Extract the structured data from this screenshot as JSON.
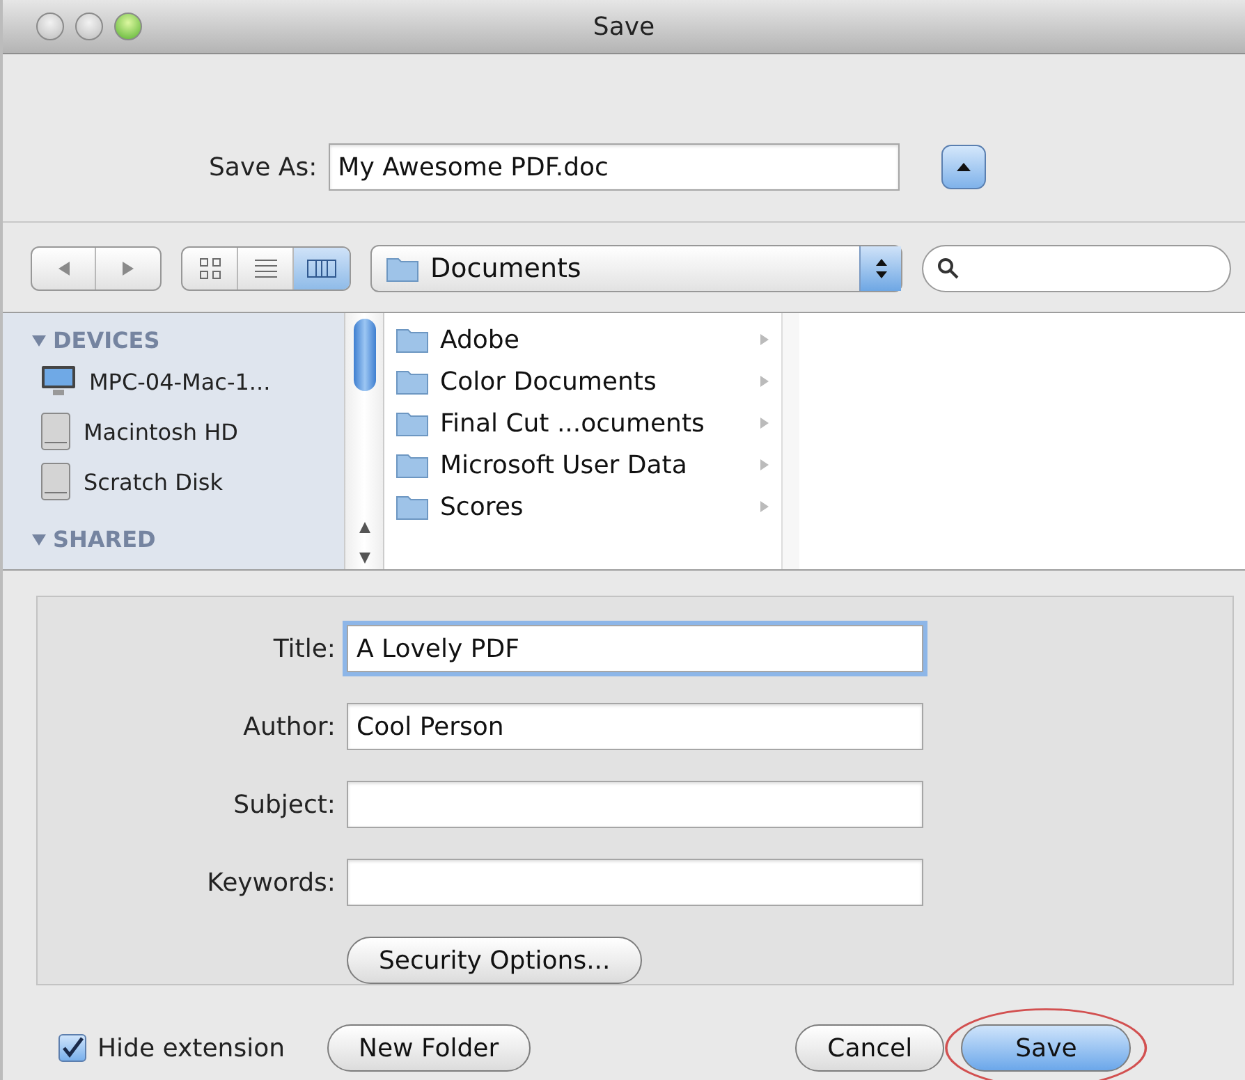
{
  "window": {
    "title": "Save"
  },
  "save_as": {
    "label": "Save As:",
    "value": "My Awesome PDF.doc",
    "expanded": true
  },
  "toolbar": {
    "views": [
      {
        "kind": "icons",
        "selected": false
      },
      {
        "kind": "list",
        "selected": false
      },
      {
        "kind": "columns",
        "selected": true
      }
    ],
    "location": "Documents"
  },
  "sidebar": [
    {
      "heading": "DEVICES",
      "expanded": true,
      "items": [
        {
          "kind": "computer",
          "label": "MPC-04-Mac-1..."
        },
        {
          "kind": "disk",
          "label": "Macintosh HD"
        },
        {
          "kind": "disk",
          "label": "Scratch Disk"
        }
      ]
    },
    {
      "heading": "SHARED",
      "expanded": true
    }
  ],
  "column": [
    {
      "label": "Adobe",
      "selected": false
    },
    {
      "label": "Color Documents",
      "selected": false
    },
    {
      "label": "Final Cut ...ocuments",
      "selected": false
    },
    {
      "label": "Microsoft User Data",
      "selected": false
    },
    {
      "label": "Scores",
      "selected": false
    }
  ],
  "fields": [
    {
      "label": "Title:",
      "value": "A Lovely PDF",
      "focused": true
    },
    {
      "label": "Author:",
      "value": "Cool Person",
      "focused": false
    },
    {
      "label": "Subject:",
      "focused": false
    },
    {
      "label": "Keywords:",
      "focused": false
    }
  ],
  "security_button": "Security Options...",
  "hide_extension": {
    "label": "Hide extension",
    "checked": true
  },
  "buttons": [
    {
      "label": "New Folder",
      "default": false,
      "circled": false
    },
    {
      "label": "Cancel",
      "default": false,
      "circled": false
    },
    {
      "label": "Save",
      "default": true,
      "circled": true
    }
  ]
}
